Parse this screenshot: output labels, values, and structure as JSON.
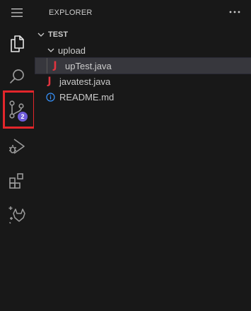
{
  "sidebar": {
    "title": "EXPLORER",
    "more_actions": "···"
  },
  "activity_bar": {
    "source_control_badge": "2",
    "highlight_color": "#e3262b",
    "badge_color": "#6e5bd8",
    "icons": [
      "menu-icon",
      "explorer-icon",
      "search-icon",
      "source-control-icon",
      "run-debug-icon",
      "extensions-icon",
      "gitlab-icon"
    ]
  },
  "tree": {
    "root": "TEST",
    "folder": "upload",
    "files": {
      "uptest": "upTest.java",
      "javatest": "javatest.java",
      "readme": "README.md"
    },
    "java_glyph": "J"
  },
  "colors": {
    "background": "#181818",
    "selected_row": "#37373d",
    "java_icon": "#e2343f",
    "info_icon": "#3794ff"
  }
}
